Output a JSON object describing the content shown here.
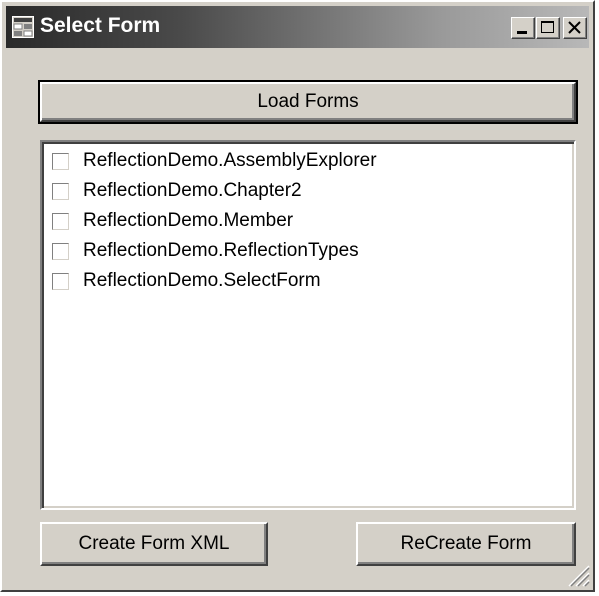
{
  "window": {
    "title": "Select Form"
  },
  "toolbar": {
    "load_label": "Load Forms"
  },
  "form_list": {
    "items": [
      {
        "label": "ReflectionDemo.AssemblyExplorer",
        "checked": false
      },
      {
        "label": "ReflectionDemo.Chapter2",
        "checked": false
      },
      {
        "label": "ReflectionDemo.Member",
        "checked": false
      },
      {
        "label": "ReflectionDemo.ReflectionTypes",
        "checked": false
      },
      {
        "label": "ReflectionDemo.SelectForm",
        "checked": false
      }
    ]
  },
  "actions": {
    "create_label": "Create Form XML",
    "recreate_label": "ReCreate Form"
  },
  "icons": {
    "app": "form-window-icon",
    "minimize": "minimize-icon",
    "maximize": "maximize-icon",
    "close": "close-icon",
    "checkbox": "checkbox-icon",
    "resize": "resize-grip-icon"
  },
  "colors": {
    "face": "#d4d0c8",
    "title_start": "#2a2a2a",
    "title_end": "#b8b8b8",
    "title_text": "#ffffff",
    "list_background": "#ffffff"
  }
}
